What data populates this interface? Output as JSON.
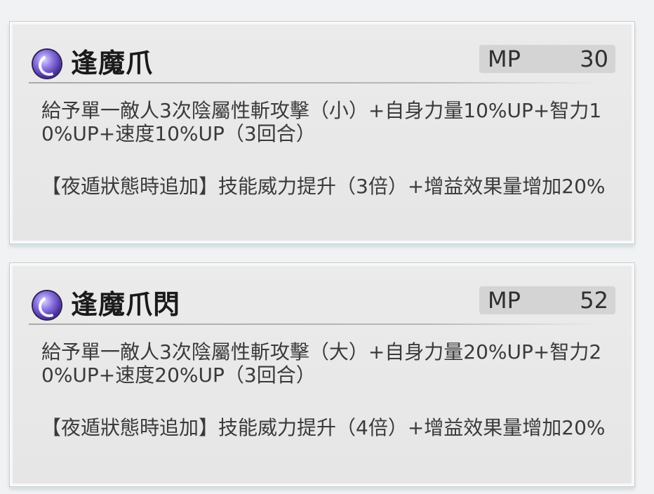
{
  "skills": [
    {
      "name": "逢魔爪",
      "mp_label": "MP",
      "mp_value": "30",
      "description": "給予單一敵人3次陰屬性斬攻擊（小）+自身力量10%UP+智力10%UP+速度10%UP（3回合）",
      "extra": "【夜遁狀態時追加】技能威力提升（3倍）+增益效果量增加20%",
      "icon": "dark-element-icon"
    },
    {
      "name": "逢魔爪閃",
      "mp_label": "MP",
      "mp_value": "52",
      "description": "給予單一敵人3次陰屬性斬攻擊（大）+自身力量20%UP+智力20%UP+速度20%UP（3回合）",
      "extra": "【夜遁狀態時追加】技能威力提升（4倍）+增益效果量增加20%",
      "icon": "dark-element-icon"
    }
  ],
  "colors": {
    "card_bg": "#e8e8e8",
    "badge_bg": "#d4d4d4",
    "text": "#3a3a3a",
    "title": "#1a1a1a"
  }
}
